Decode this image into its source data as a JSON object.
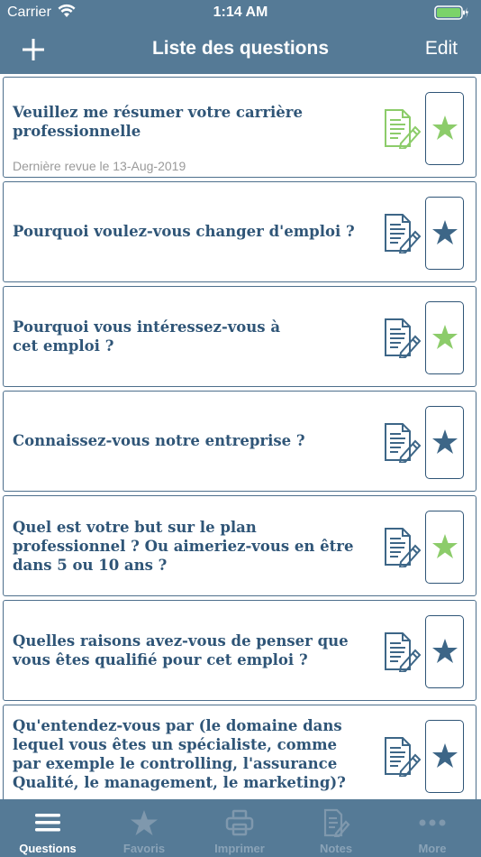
{
  "status_bar": {
    "carrier": "Carrier",
    "time": "1:14 AM"
  },
  "nav": {
    "title": "Liste des questions",
    "edit_label": "Edit",
    "add_icon": "plus-icon"
  },
  "colors": {
    "bar": "#557a96",
    "question_text": "#2f5577",
    "green": "#8ccc6a",
    "blue_icon": "#3d6687"
  },
  "questions": [
    {
      "text": "Veuillez me résumer votre carrière professionnelle",
      "last_review": "Dernière revue le 13-Aug-2019",
      "notes_color": "green",
      "favorite_color": "green"
    },
    {
      "text": "Pourquoi voulez-vous changer d'emploi ?",
      "notes_color": "blue",
      "favorite_color": "blue"
    },
    {
      "text": "Pourquoi vous intéressez-vous à cet emploi ?",
      "notes_color": "blue",
      "favorite_color": "green"
    },
    {
      "text": "Connaissez-vous notre entreprise ?",
      "notes_color": "blue",
      "favorite_color": "blue"
    },
    {
      "text": "Quel est votre but sur le plan professionnel ? Ou aimeriez-vous en être dans 5 ou 10 ans ?",
      "notes_color": "blue",
      "favorite_color": "green"
    },
    {
      "text": "Quelles raisons avez-vous de penser que vous êtes qualifié pour cet emploi ?",
      "notes_color": "blue",
      "favorite_color": "blue"
    },
    {
      "text": "Qu'entendez-vous par (le domaine dans lequel vous êtes un spécialiste, comme par exemple le controlling, l'assurance Qualité, le management, le marketing)?",
      "notes_color": "blue",
      "favorite_color": "blue"
    }
  ],
  "tabs": [
    {
      "label": "Questions",
      "icon": "list-icon",
      "active": true
    },
    {
      "label": "Favoris",
      "icon": "star-icon",
      "active": false
    },
    {
      "label": "Imprimer",
      "icon": "printer-icon",
      "active": false
    },
    {
      "label": "Notes",
      "icon": "notes-icon",
      "active": false
    },
    {
      "label": "More",
      "icon": "more-icon",
      "active": false
    }
  ]
}
